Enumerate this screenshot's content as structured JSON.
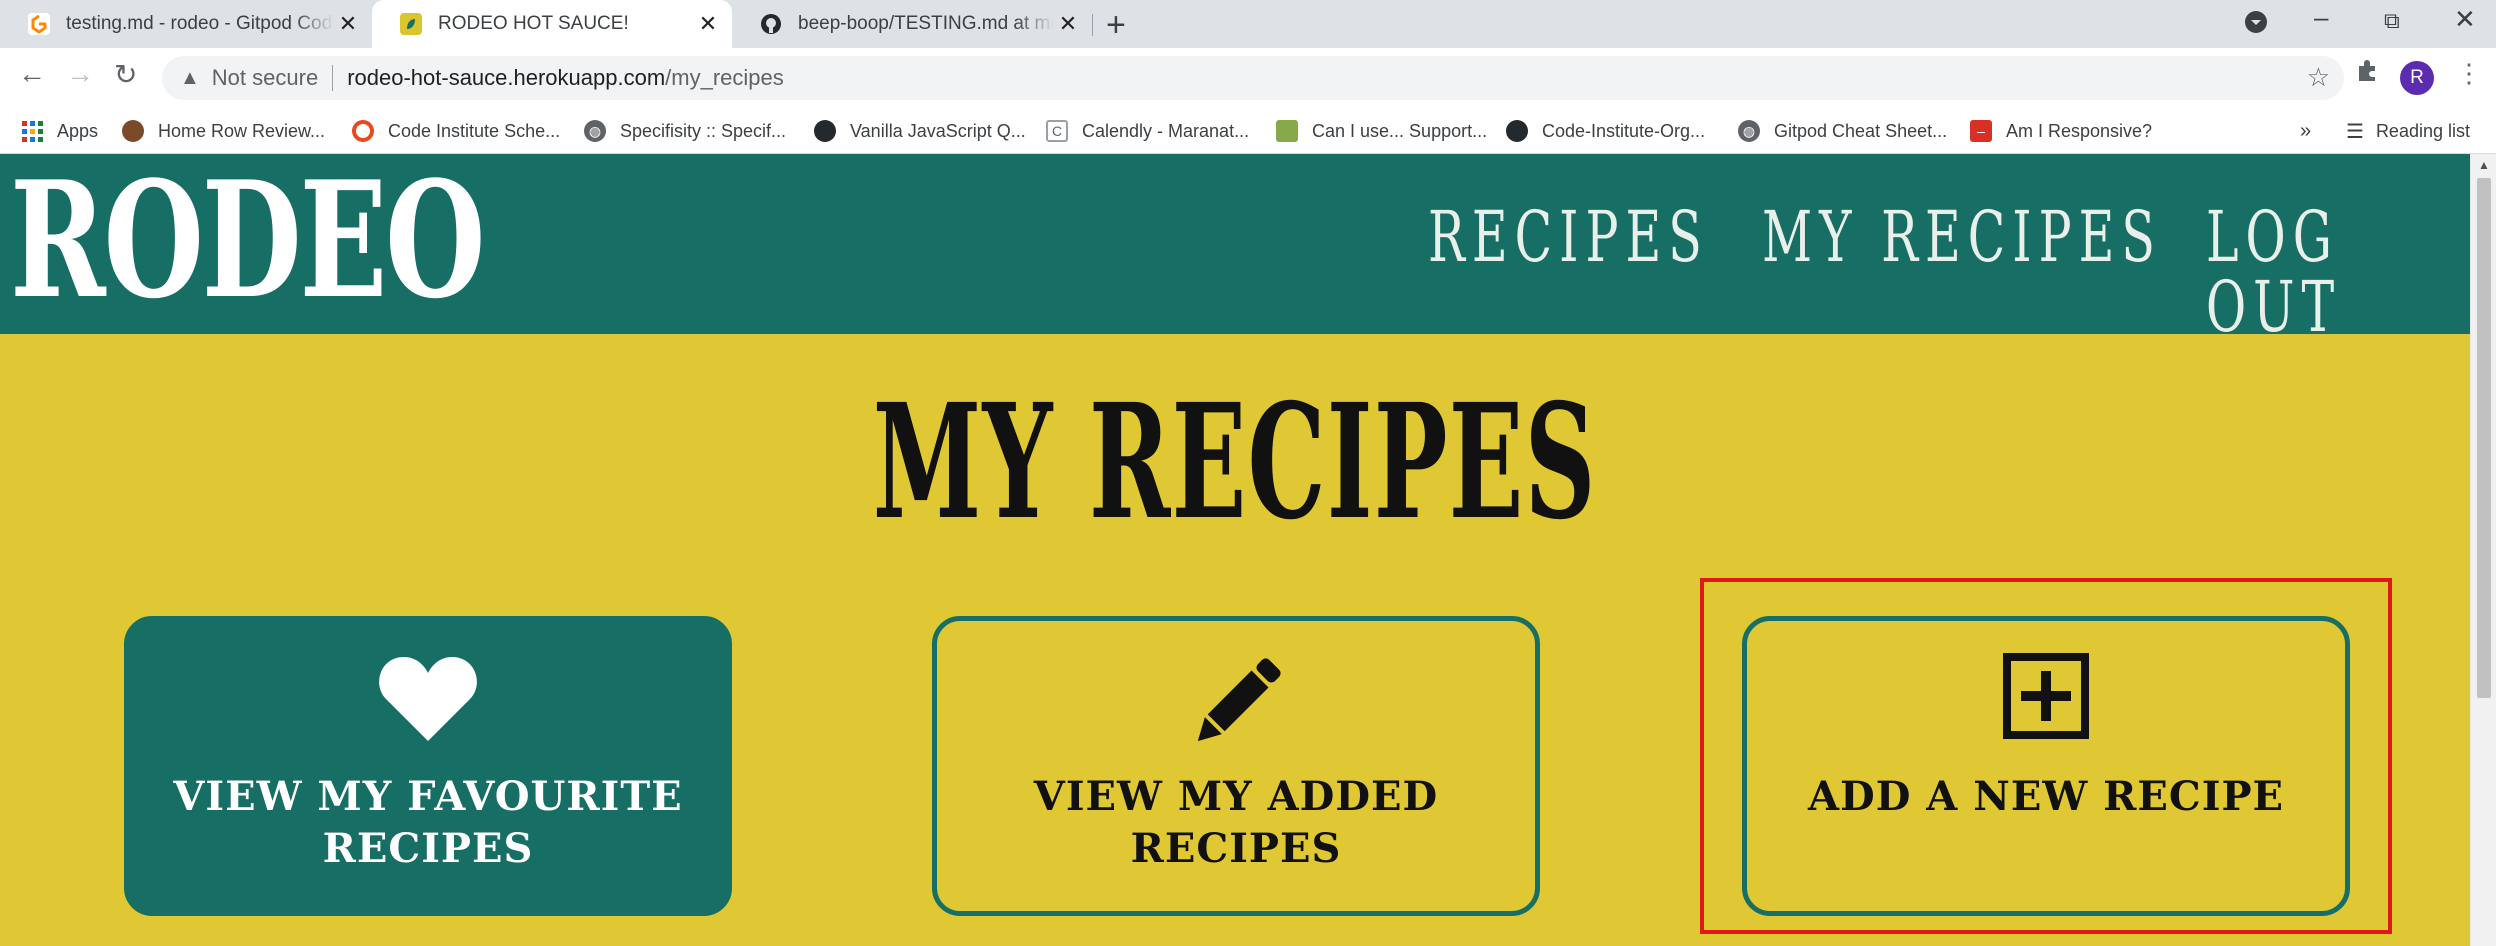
{
  "browser": {
    "tabs": [
      {
        "title": "testing.md - rodeo - Gitpod Code",
        "active": false
      },
      {
        "title": "RODEO HOT SAUCE!",
        "active": true
      },
      {
        "title": "beep-boop/TESTING.md at master",
        "active": false
      }
    ],
    "address": {
      "security": "Not secure",
      "host": "rodeo-hot-sauce.herokuapp.com",
      "path": "/my_recipes"
    },
    "profile_initial": "R",
    "bookmarks": [
      "Apps",
      "Home Row Review...",
      "Code Institute Sche...",
      "Specifisity :: Specif...",
      "Vanilla JavaScript Q...",
      "Calendly - Maranat...",
      "Can I use... Support...",
      "Code-Institute-Org...",
      "Gitpod Cheat Sheet...",
      "Am I Responsive?"
    ],
    "overflow": "»",
    "reading_list": "Reading list"
  },
  "site": {
    "logo": "RODEO",
    "nav": [
      "RECIPES",
      "MY RECIPES",
      "LOG OUT"
    ],
    "title": "MY RECIPES",
    "cards": [
      {
        "label": "VIEW MY FAVOURITE RECIPES",
        "icon": "heart-icon",
        "style": "filled"
      },
      {
        "label": "VIEW MY ADDED RECIPES",
        "icon": "pencil-icon",
        "style": "outline"
      },
      {
        "label": "ADD A NEW RECIPE",
        "icon": "plus-square-icon",
        "style": "outline",
        "highlighted": true
      }
    ]
  },
  "colors": {
    "page_bg": "#e0c834",
    "nav_bg": "#166e64",
    "highlight": "#e01818"
  }
}
